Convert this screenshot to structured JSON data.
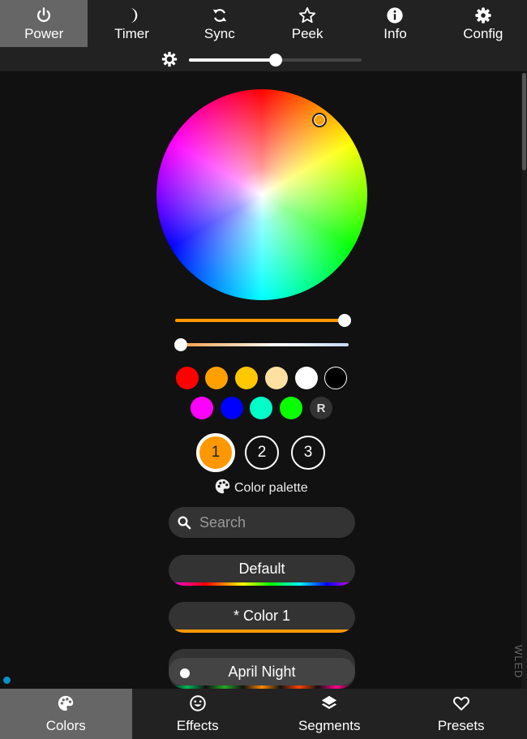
{
  "topnav": {
    "items": [
      {
        "label": "Power",
        "icon": "power-icon",
        "active": true
      },
      {
        "label": "Timer",
        "icon": "moon-icon",
        "active": false
      },
      {
        "label": "Sync",
        "icon": "sync-icon",
        "active": false
      },
      {
        "label": "Peek",
        "icon": "star-icon",
        "active": false
      },
      {
        "label": "Info",
        "icon": "info-icon",
        "active": false
      },
      {
        "label": "Config",
        "icon": "gear-icon",
        "active": false
      }
    ],
    "brightness": 0.5
  },
  "color": {
    "current": "#ffa000",
    "value_slider": 1.0,
    "white_slider": 0.0,
    "quick_colors": [
      {
        "name": "red",
        "color": "#ff0000"
      },
      {
        "name": "orange",
        "color": "#ffa000"
      },
      {
        "name": "yellow",
        "color": "#ffc800"
      },
      {
        "name": "warm-white",
        "color": "#ffe0a0"
      },
      {
        "name": "white",
        "color": "#ffffff"
      },
      {
        "name": "black",
        "color": "#000000"
      },
      {
        "name": "magenta",
        "color": "#ff00ff"
      },
      {
        "name": "blue",
        "color": "#0000ff"
      },
      {
        "name": "cyan",
        "color": "#00ffc8"
      },
      {
        "name": "green",
        "color": "#08ff00"
      }
    ],
    "random_label": "R",
    "slots": [
      "1",
      "2",
      "3"
    ],
    "selected_slot": "1"
  },
  "palette": {
    "label": "Color palette",
    "search_placeholder": "Search",
    "items": [
      {
        "name": "Default",
        "selected": false
      },
      {
        "name": "* Color 1",
        "selected": false
      },
      {
        "name": "April Night",
        "selected": true
      }
    ]
  },
  "brand": "WLED",
  "bottomnav": {
    "items": [
      {
        "label": "Colors",
        "icon": "palette-icon",
        "active": true
      },
      {
        "label": "Effects",
        "icon": "smiley-icon",
        "active": false
      },
      {
        "label": "Segments",
        "icon": "layers-icon",
        "active": false
      },
      {
        "label": "Presets",
        "icon": "heart-icon",
        "active": false
      }
    ]
  }
}
